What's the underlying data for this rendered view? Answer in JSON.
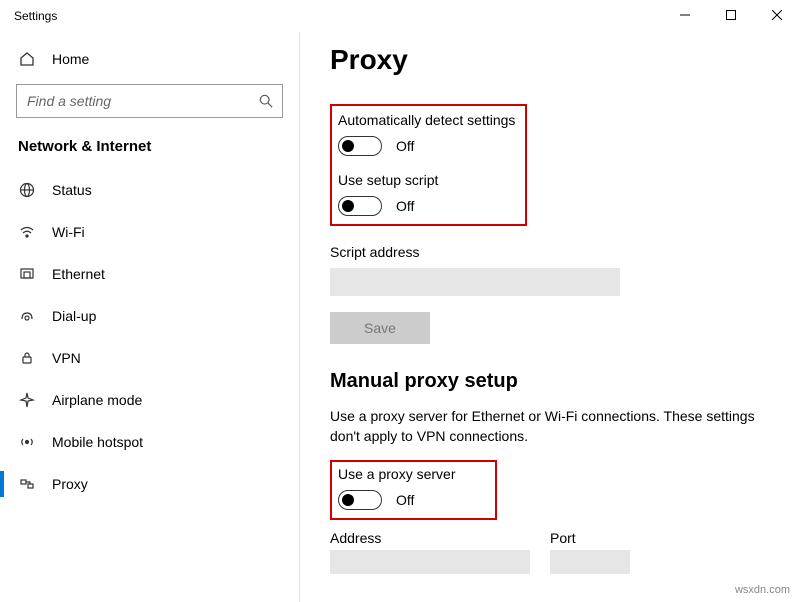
{
  "window": {
    "title": "Settings"
  },
  "sidebar": {
    "home": "Home",
    "search_placeholder": "Find a setting",
    "category": "Network & Internet",
    "items": [
      {
        "label": "Status",
        "icon": "globe"
      },
      {
        "label": "Wi-Fi",
        "icon": "wifi"
      },
      {
        "label": "Ethernet",
        "icon": "ethernet"
      },
      {
        "label": "Dial-up",
        "icon": "dialup"
      },
      {
        "label": "VPN",
        "icon": "vpn"
      },
      {
        "label": "Airplane mode",
        "icon": "airplane"
      },
      {
        "label": "Mobile hotspot",
        "icon": "hotspot"
      },
      {
        "label": "Proxy",
        "icon": "proxy",
        "selected": true
      }
    ]
  },
  "main": {
    "title": "Proxy",
    "auto_detect": {
      "label": "Automatically detect settings",
      "state": "Off"
    },
    "setup_script": {
      "label": "Use setup script",
      "state": "Off"
    },
    "script_address_label": "Script address",
    "save_label": "Save",
    "manual_title": "Manual proxy setup",
    "manual_desc": "Use a proxy server for Ethernet or Wi-Fi connections. These settings don't apply to VPN connections.",
    "use_proxy": {
      "label": "Use a proxy server",
      "state": "Off"
    },
    "address_label": "Address",
    "port_label": "Port"
  },
  "watermark": "wsxdn.com"
}
